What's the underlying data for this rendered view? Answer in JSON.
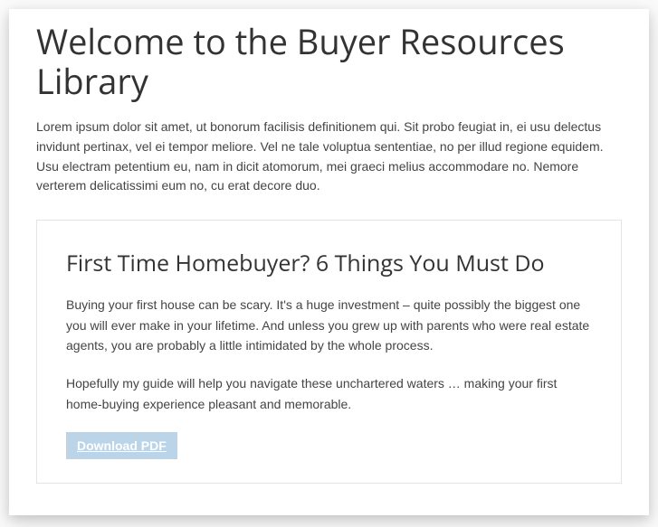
{
  "page": {
    "title": "Welcome to the Buyer Resources Library",
    "intro": "Lorem ipsum dolor sit amet, ut bonorum facilisis definitionem qui. Sit probo feugiat in, ei usu delectus invidunt pertinax, vel ei tempor meliore. Vel ne tale voluptua sententiae, no per illud regione equidem. Usu electram petentium eu, nam in dicit atomorum, mei graeci melius accommodare no. Nemore verterem delicatissimi eum no, cu erat decore duo."
  },
  "card": {
    "title": "First Time Homebuyer? 6 Things You Must Do",
    "paragraph1": "Buying your first house can be scary. It's a huge investment – quite possibly the biggest one you will ever make in your lifetime. And unless you grew up with parents who were real estate agents, you are probably a little intimidated by the whole process.",
    "paragraph2": "Hopefully my guide will help you navigate these unchartered waters … making your first home-buying experience pleasant and memorable.",
    "button_label": "Download PDF"
  }
}
